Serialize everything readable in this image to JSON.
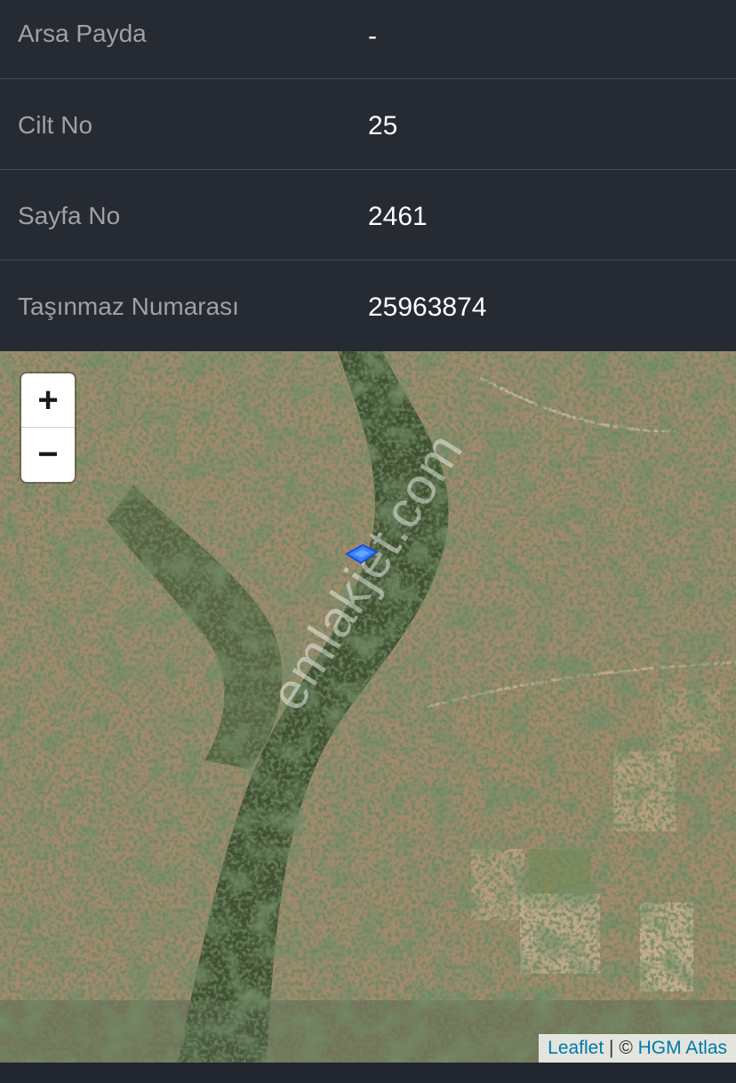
{
  "details": {
    "rows": [
      {
        "label": "Arsa Payda",
        "value": "-"
      },
      {
        "label": "Cilt No",
        "value": "25"
      },
      {
        "label": "Sayfa No",
        "value": "2461"
      },
      {
        "label": "Taşınmaz Numarası",
        "value": "25963874"
      }
    ]
  },
  "map": {
    "zoom_in_label": "+",
    "zoom_out_label": "−",
    "watermark": "emlakjet.com",
    "attribution": {
      "leaflet": "Leaflet",
      "separator": " | © ",
      "provider": "HGM Atlas"
    },
    "marker_color": "#3b82f6"
  }
}
